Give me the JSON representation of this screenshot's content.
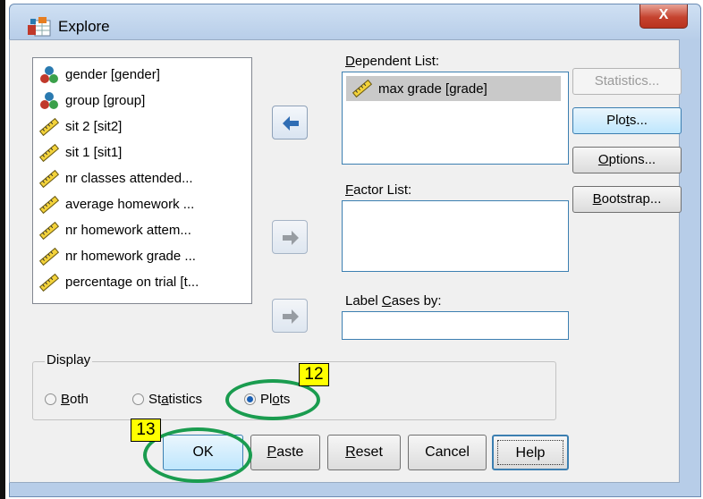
{
  "window": {
    "title": "Explore",
    "close_label": "X"
  },
  "variables": [
    {
      "label": "gender [gender]",
      "icon": "nominal-icon"
    },
    {
      "label": "group [group]",
      "icon": "nominal-icon"
    },
    {
      "label": "sit 2 [sit2]",
      "icon": "scale-icon"
    },
    {
      "label": "sit 1 [sit1]",
      "icon": "scale-icon"
    },
    {
      "label": "nr classes attended...",
      "icon": "scale-icon"
    },
    {
      "label": "average homework ...",
      "icon": "scale-icon"
    },
    {
      "label": "nr homework attem...",
      "icon": "scale-icon"
    },
    {
      "label": "nr homework grade ...",
      "icon": "scale-icon"
    },
    {
      "label": "percentage on trial [t...",
      "icon": "scale-icon"
    }
  ],
  "dependent": {
    "label_pre": "",
    "label_ul": "D",
    "label_post": "ependent List:",
    "items": [
      "max grade [grade]"
    ]
  },
  "factor": {
    "label_ul": "F",
    "label_post": "actor List:"
  },
  "label_cases": {
    "label_pre": "Label ",
    "label_ul": "C",
    "label_post": "ases by:"
  },
  "side_buttons": {
    "statistics": "Statistics...",
    "plots_pre": "Plo",
    "plots_ul": "t",
    "plots_post": "s...",
    "options_ul": "O",
    "options_post": "ptions...",
    "bootstrap_ul": "B",
    "bootstrap_post": "ootstrap..."
  },
  "display": {
    "label": "Display",
    "options": [
      {
        "pre": "",
        "ul": "B",
        "post": "oth",
        "checked": false
      },
      {
        "pre": "St",
        "ul": "a",
        "post": "tistics",
        "checked": false
      },
      {
        "pre": "Pl",
        "ul": "o",
        "post": "ts",
        "checked": true
      }
    ]
  },
  "bottom_buttons": {
    "ok": "OK",
    "paste_ul": "P",
    "paste_post": "aste",
    "reset_ul": "R",
    "reset_post": "eset",
    "cancel": "Cancel",
    "help": "Help"
  },
  "annotations": {
    "badge_plots": "12",
    "badge_ok": "13"
  },
  "colors": {
    "annotation_ring": "#1a9c4f",
    "badge_bg": "#ffff00",
    "selection": "#c9c9c9"
  }
}
